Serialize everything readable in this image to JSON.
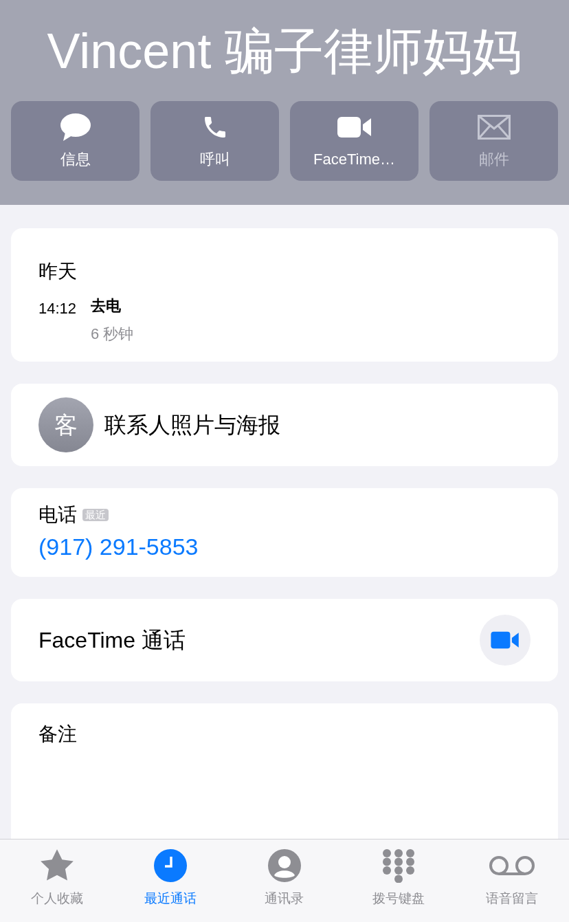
{
  "header": {
    "title": "Vincent 骗子律师妈妈"
  },
  "actions": [
    {
      "kind": "message",
      "label": "信息",
      "disabled": false
    },
    {
      "kind": "call",
      "label": "呼叫",
      "disabled": false
    },
    {
      "kind": "video",
      "label": "FaceTime…",
      "disabled": false
    },
    {
      "kind": "mail",
      "label": "邮件",
      "disabled": true
    }
  ],
  "recents": {
    "day": "昨天",
    "calls": [
      {
        "time": "14:12",
        "type": "去电",
        "duration": "6 秒钟"
      }
    ]
  },
  "contact_photo": {
    "initial": "客",
    "label": "联系人照片与海报"
  },
  "phone": {
    "label": "电话",
    "badge": "最近",
    "number": "(917) 291-5853"
  },
  "facetime": {
    "label": "FaceTime 通话"
  },
  "notes": {
    "label": "备注"
  },
  "tab_bar": [
    {
      "kind": "favorites",
      "label": "个人收藏",
      "selected": false
    },
    {
      "kind": "recents",
      "label": "最近通话",
      "selected": true
    },
    {
      "kind": "contacts",
      "label": "通讯录",
      "selected": false
    },
    {
      "kind": "keypad",
      "label": "拨号键盘",
      "selected": false
    },
    {
      "kind": "voicemail",
      "label": "语音留言",
      "selected": false
    }
  ]
}
